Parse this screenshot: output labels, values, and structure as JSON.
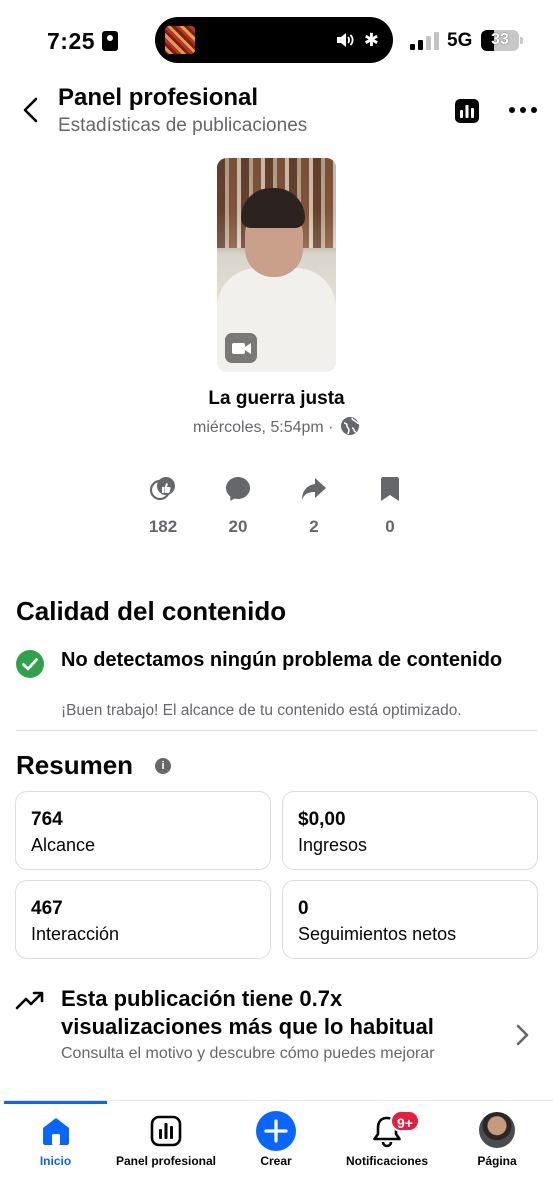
{
  "status_bar": {
    "time": "7:25",
    "network": "5G",
    "battery": "33"
  },
  "header": {
    "title": "Panel profesional",
    "subtitle": "Estadísticas de publicaciones"
  },
  "post": {
    "title": "La guerra justa",
    "meta": "miércoles, 5:54pm ·"
  },
  "stats": [
    {
      "icon": "reactions-icon",
      "value": "182"
    },
    {
      "icon": "comment-icon",
      "value": "20"
    },
    {
      "icon": "share-icon",
      "value": "2"
    },
    {
      "icon": "bookmark-icon",
      "value": "0"
    }
  ],
  "quality": {
    "heading": "Calidad del contenido",
    "title": "No detectamos ningún problema de contenido",
    "subtitle": "¡Buen trabajo! El alcance de tu contenido está optimizado."
  },
  "summary": {
    "heading": "Resumen",
    "cards": [
      {
        "value": "764",
        "label": "Alcance"
      },
      {
        "value": "$0,00",
        "label": "Ingresos"
      },
      {
        "value": "467",
        "label": "Interacción"
      },
      {
        "value": "0",
        "label": "Seguimientos netos"
      }
    ]
  },
  "insight": {
    "title": "Esta publicación tiene 0.7x visualizaciones más que lo habitual",
    "subtitle": "Consulta el motivo y descubre cómo puedes mejorar"
  },
  "bottom_nav": {
    "items": [
      {
        "label": "Inicio",
        "icon": "home-icon"
      },
      {
        "label": "Panel profesional",
        "icon": "dashboard-icon"
      },
      {
        "label": "Crear",
        "icon": "plus-icon"
      },
      {
        "label": "Notificaciones",
        "icon": "bell-icon"
      },
      {
        "label": "Página",
        "icon": "avatar"
      }
    ],
    "notification_badge": "9+"
  },
  "colors": {
    "accent": "#0866ff",
    "success": "#31a24c",
    "badge": "#e41e3f",
    "secondary_text": "#65676b"
  }
}
